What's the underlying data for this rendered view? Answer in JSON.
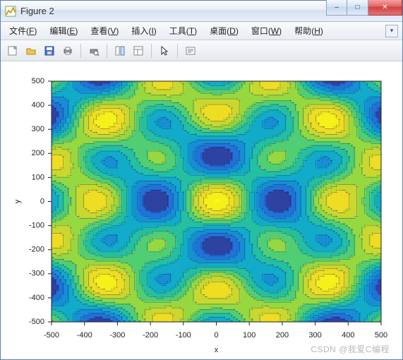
{
  "window": {
    "title": "Figure 2",
    "buttons": {
      "min": "–",
      "max": "□",
      "close": "✕"
    }
  },
  "menu": {
    "items": [
      {
        "label": "文件",
        "accel": "F"
      },
      {
        "label": "编辑",
        "accel": "E"
      },
      {
        "label": "查看",
        "accel": "V"
      },
      {
        "label": "插入",
        "accel": "I"
      },
      {
        "label": "工具",
        "accel": "T"
      },
      {
        "label": "桌面",
        "accel": "D"
      },
      {
        "label": "窗口",
        "accel": "W"
      },
      {
        "label": "帮助",
        "accel": "H"
      }
    ]
  },
  "toolbar": {
    "icons": [
      "new-figure",
      "open",
      "save",
      "print",
      "sep",
      "print-preview",
      "sep",
      "dock",
      "layout",
      "sep",
      "pointer",
      "sep",
      "datatip"
    ]
  },
  "chart_data": {
    "type": "contour",
    "title": "",
    "xlabel": "x",
    "ylabel": "y",
    "xlim": [
      -500,
      500
    ],
    "ylim": [
      -500,
      500
    ],
    "xticks": [
      -500,
      -400,
      -300,
      -200,
      -100,
      0,
      100,
      200,
      300,
      400,
      500
    ],
    "yticks": [
      -500,
      -400,
      -300,
      -200,
      -100,
      0,
      100,
      200,
      300,
      400,
      500
    ],
    "function": "sin(sqrt(x^2+y^2)/50) style radial-periodic surface producing 4-fold symmetric filled contours",
    "colormap": "parula",
    "levels_approx": 10,
    "grid": false,
    "legend": null
  },
  "watermark": "CSDN @我爱C编程"
}
